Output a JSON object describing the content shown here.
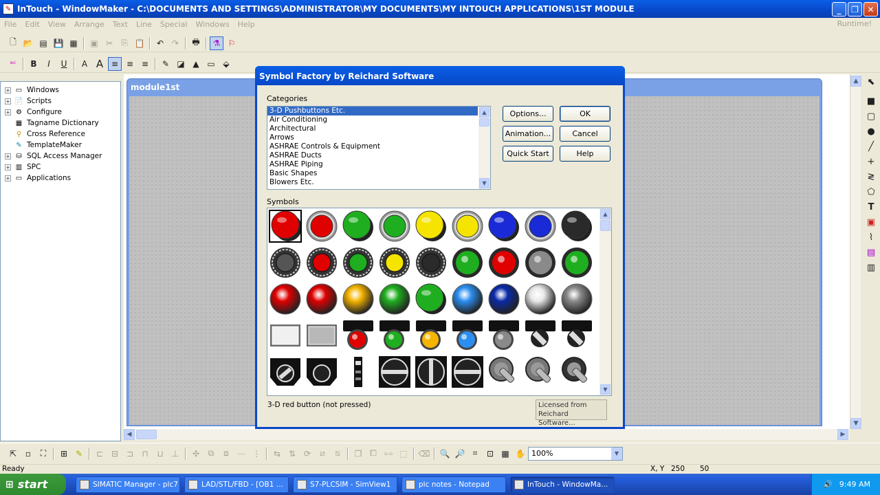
{
  "window": {
    "title": "InTouch - WindowMaker - C:\\DOCUMENTS AND SETTINGS\\ADMINISTRATOR\\MY DOCUMENTS\\MY INTOUCH APPLICATIONS\\1ST MODULE",
    "app_icon": "intouch-app-icon"
  },
  "menubar": {
    "items": [
      "File",
      "Edit",
      "View",
      "Arrange",
      "Text",
      "Line",
      "Special",
      "Windows",
      "Help"
    ],
    "runtime": "Runtime!"
  },
  "tree": {
    "items": [
      {
        "label": "Windows",
        "expand": "+",
        "icon": "window-icon"
      },
      {
        "label": "Scripts",
        "expand": "+",
        "icon": "script-icon"
      },
      {
        "label": "Configure",
        "expand": "+",
        "icon": "configure-icon"
      },
      {
        "label": "Tagname Dictionary",
        "expand": "",
        "icon": "dictionary-icon"
      },
      {
        "label": "Cross Reference",
        "expand": "",
        "icon": "cross-reference-icon"
      },
      {
        "label": "TemplateMaker",
        "expand": "",
        "icon": "template-icon"
      },
      {
        "label": "SQL Access Manager",
        "expand": "+",
        "icon": "sql-icon"
      },
      {
        "label": "SPC",
        "expand": "+",
        "icon": "spc-icon"
      },
      {
        "label": "Applications",
        "expand": "+",
        "icon": "applications-icon"
      }
    ]
  },
  "module": {
    "title": "module1st"
  },
  "dialog": {
    "title": "Symbol Factory by Reichard Software",
    "categories_label": "Categories",
    "categories": [
      "3-D Pushbuttons Etc.",
      "Air Conditioning",
      "Architectural",
      "Arrows",
      "ASHRAE Controls & Equipment",
      "ASHRAE Ducts",
      "ASHRAE Piping",
      "Basic Shapes",
      "Blowers Etc."
    ],
    "selected_category_index": 0,
    "buttons": {
      "options": "Options...",
      "ok": "OK",
      "animation": "Animation...",
      "cancel": "Cancel",
      "quick_start": "Quick Start",
      "help": "Help"
    },
    "symbols_label": "Symbols",
    "symbol_caption": "3-D red button (not pressed)",
    "licensed_line1": "Licensed from",
    "licensed_line2": "Reichard Software..."
  },
  "symbols": [
    [
      "red-3d-button",
      "red-button-ring",
      "green-3d-button",
      "green-button-ring",
      "yellow-3d-button",
      "yellow-button-ring",
      "blue-3d-button",
      "blue-button-ring",
      "black-3d-button"
    ],
    [
      "gray-round-button",
      "red-bezel-button",
      "green-bezel-button",
      "yellow-bezel-button",
      "black-bezel-button",
      "green-pilot-light",
      "red-pilot-light",
      "gray-pilot-light",
      "green-flat-light"
    ],
    [
      "red-dome-light",
      "red-glossy-light",
      "yellow-glossy-light",
      "green-glossy-light",
      "green-dark-light",
      "blue-glossy-light",
      "navy-glossy-light",
      "white-glossy-light",
      "gray-glossy-light"
    ],
    [
      "white-rect-button",
      "gray-rect-button",
      "red-mount-light",
      "green-mount-light",
      "yellow-mount-light",
      "blue-mount-light",
      "gray-mount-light",
      "selector-switch-mount",
      "key-switch-mount"
    ],
    [
      "selector-switch-left",
      "ring-switch",
      "slider-switch",
      "rotary-switch-horizontal",
      "rotary-switch-vertical",
      "rotary-switch-horizontal-2",
      "gray-lever-switch",
      "gray-lever-switch-2",
      "dark-lever-switch"
    ]
  ],
  "colors": {
    "red": "#e00000",
    "green": "#1fae1f",
    "yellow": "#f5e400",
    "blue": "#1a2ad6",
    "black": "#2a2a2a",
    "gray": "#8a8a8a",
    "orange": "#f5b400",
    "lightblue": "#2b8ef0"
  },
  "bottom": {
    "zoom": "100%"
  },
  "statusbar": {
    "status": "Ready",
    "coord_label": "X, Y",
    "x": "250",
    "y": "50"
  },
  "taskbar": {
    "start": "start",
    "tasks": [
      "SIMATIC Manager - plc7",
      "LAD/STL/FBD - [OB1 ...",
      "S7-PLCSIM - SimView1",
      "plc notes - Notepad",
      "InTouch - WindowMa..."
    ],
    "active_index": 4,
    "clock": "9:49 AM"
  }
}
